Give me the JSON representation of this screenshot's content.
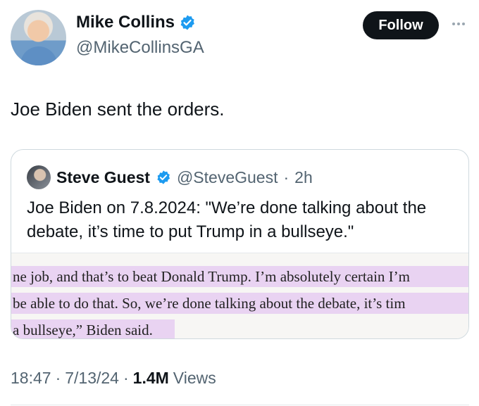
{
  "author": {
    "display_name": "Mike Collins",
    "handle": "@MikeCollinsGA",
    "verified_icon": "verified-badge-icon"
  },
  "actions": {
    "follow_label": "Follow",
    "more_icon": "more-dots-icon"
  },
  "tweet": {
    "text": "Joe Biden sent the orders."
  },
  "quote": {
    "display_name": "Steve Guest",
    "handle": "@SteveGuest",
    "separator": "·",
    "time": "2h",
    "text": "Joe Biden on 7.8.2024: \"We’re done talking about the debate, it’s time to put Trump in a bullseye.\"",
    "image_lines": [
      "ne job, and that’s to beat Donald Trump. I’m absolutely certain I’m",
      "be able to do that. So, we’re done talking about the debate, it’s tim",
      "a bullseye,” Biden said."
    ]
  },
  "meta": {
    "time": "18:47",
    "dot1": "·",
    "date": "7/13/24",
    "dot2": "·",
    "views_count": "1.4M",
    "views_label": "Views"
  },
  "colors": {
    "verified": "#1d9bf0",
    "highlight": "#e9d3f2",
    "secondary_text": "#536471"
  }
}
